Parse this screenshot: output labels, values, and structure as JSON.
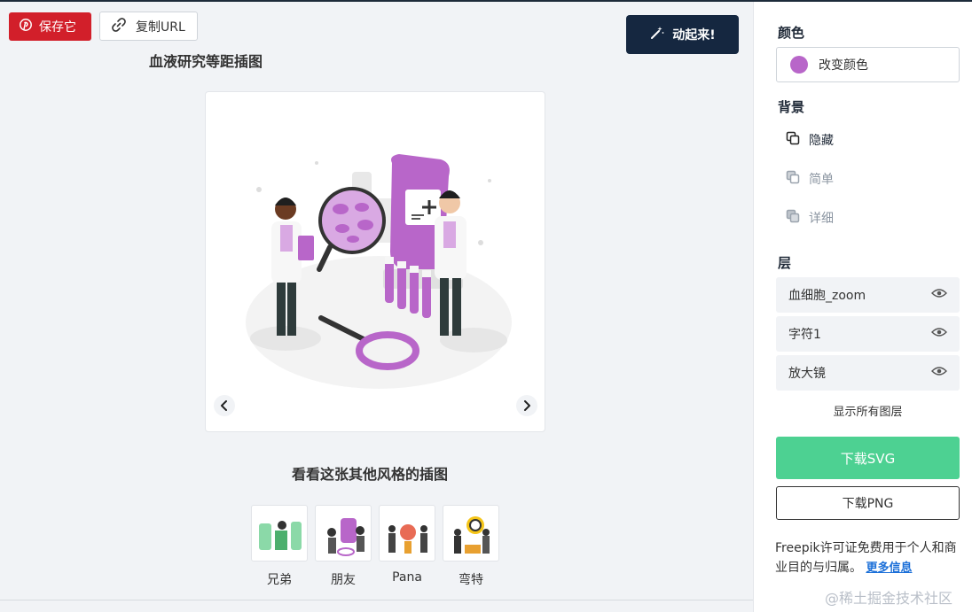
{
  "toolbar": {
    "save_label": "保存它",
    "copy_url_label": "复制URL",
    "animate_label": "动起来!"
  },
  "illustration": {
    "title": "血液研究等距插图"
  },
  "styles": {
    "heading": "看看这张其他风格的插图",
    "items": [
      {
        "label": "兄弟"
      },
      {
        "label": "朋友"
      },
      {
        "label": "Pana"
      },
      {
        "label": "弯特"
      }
    ]
  },
  "panel": {
    "color": {
      "heading": "颜色",
      "button_label": "改变颜色",
      "swatch": "#b866c9"
    },
    "background": {
      "heading": "背景",
      "options": [
        {
          "label": "隐藏"
        },
        {
          "label": "简单"
        },
        {
          "label": "详细"
        }
      ]
    },
    "layers": {
      "heading": "层",
      "items": [
        {
          "label": "血细胞_zoom"
        },
        {
          "label": "字符1"
        },
        {
          "label": "放大镜"
        }
      ],
      "show_all": "显示所有图层"
    },
    "download_svg": "下载SVG",
    "download_png": "下载PNG",
    "license_text": "Freepik许可证免费用于个人和商业目的与归属。",
    "more_info": "更多信息"
  },
  "watermark": "@稀土掘金技术社区",
  "colors": {
    "accent_purple": "#b866c9",
    "save_red": "#d21f2a",
    "animate_navy": "#152740",
    "download_green": "#4dd192"
  }
}
